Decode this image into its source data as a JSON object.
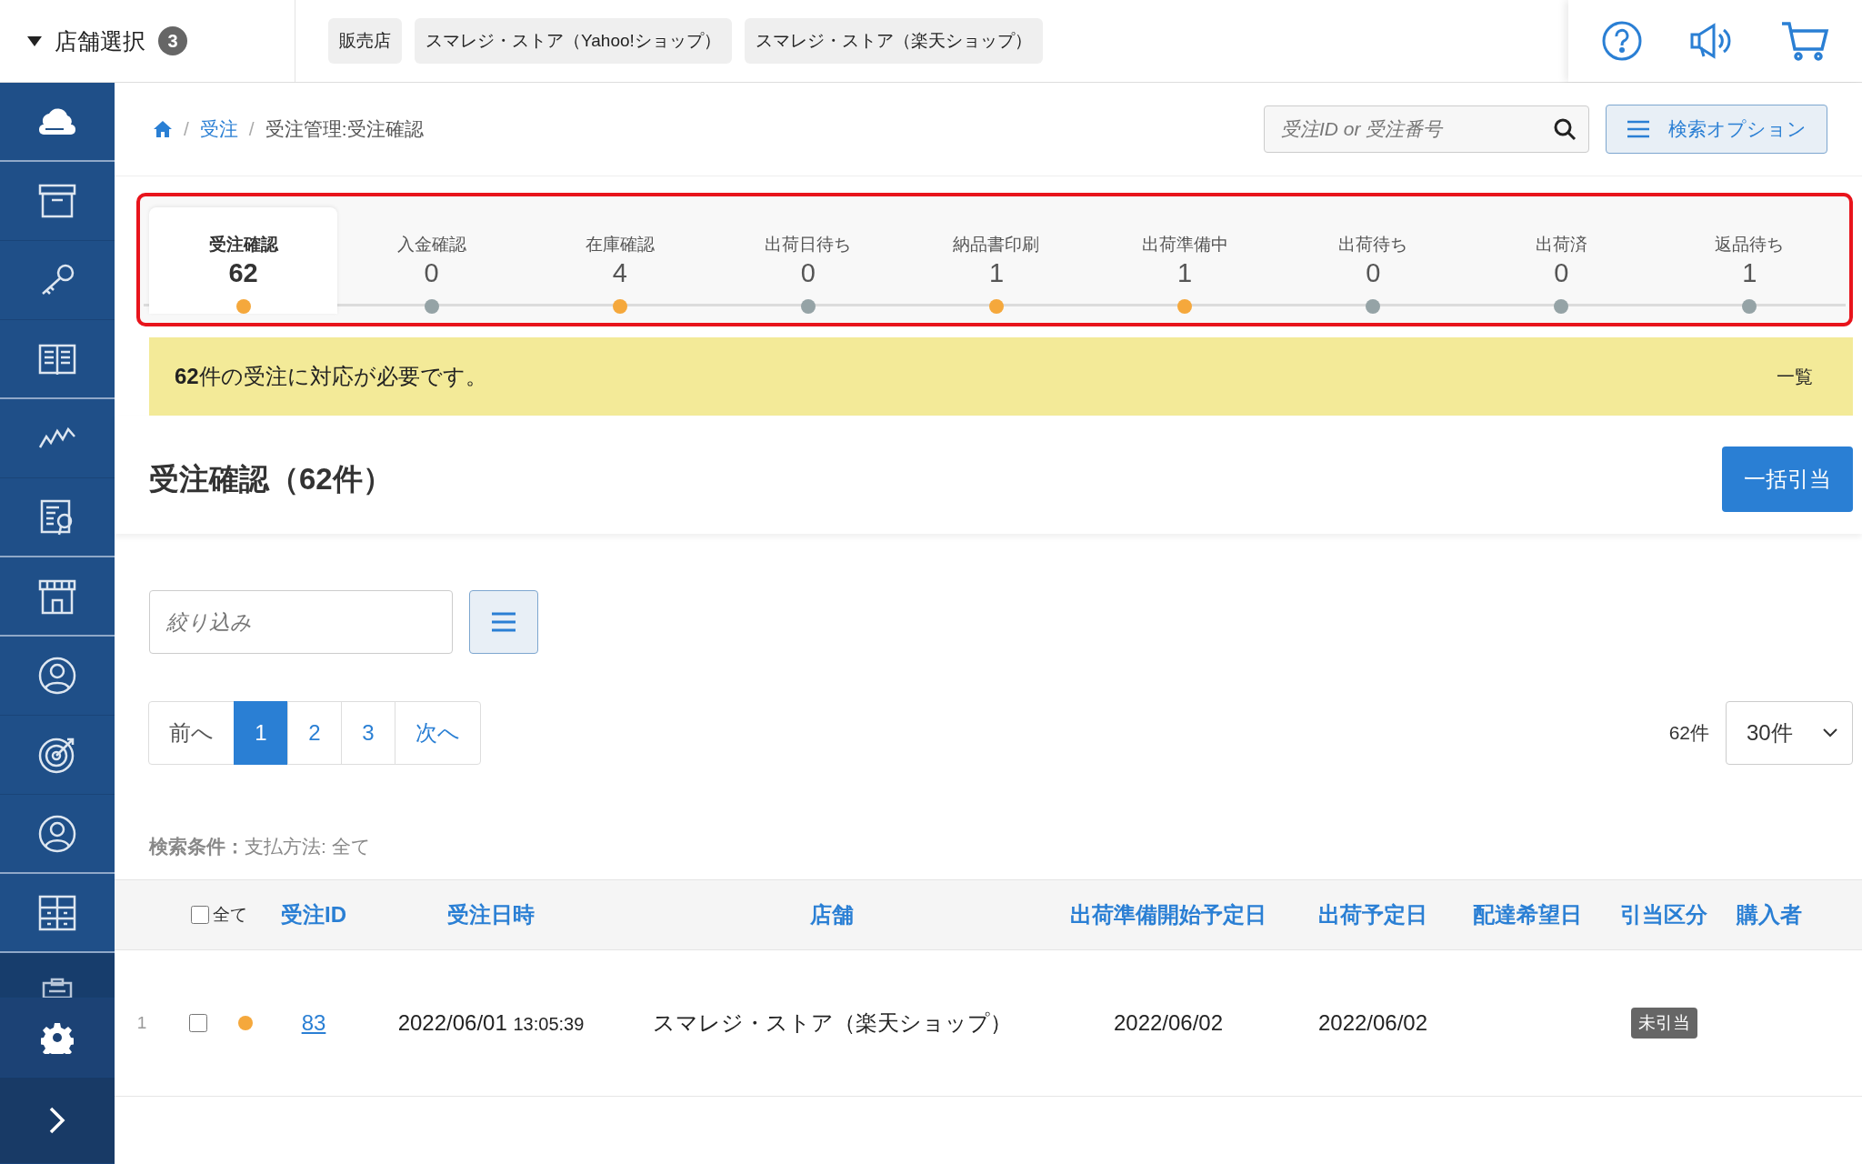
{
  "header": {
    "store_select": {
      "label": "店舗選択",
      "count": "3"
    },
    "store_chips": [
      "販売店",
      "スマレジ・ストア（Yahoo!ショップ）",
      "スマレジ・ストア（楽天ショップ）"
    ]
  },
  "breadcrumb": [
    {
      "separator": "/",
      "label": "受注",
      "link": true
    },
    {
      "separator": "/",
      "label": "受注管理:受注確認",
      "link": false
    }
  ],
  "search": {
    "placeholder": "受注ID or 受注番号"
  },
  "search_options_button": "検索オプション",
  "status_tabs": [
    {
      "label": "受注確認",
      "count": "62",
      "selected": true,
      "color": "#f5a83c"
    },
    {
      "label": "入金確認",
      "count": "0",
      "selected": false,
      "color": "#95a3a6"
    },
    {
      "label": "在庫確認",
      "count": "4",
      "selected": false,
      "color": "#f5a83c"
    },
    {
      "label": "出荷日待ち",
      "count": "0",
      "selected": false,
      "color": "#95a3a6"
    },
    {
      "label": "納品書印刷",
      "count": "1",
      "selected": false,
      "color": "#f5a83c"
    },
    {
      "label": "出荷準備中",
      "count": "1",
      "selected": false,
      "color": "#f5a83c"
    },
    {
      "label": "出荷待ち",
      "count": "0",
      "selected": false,
      "color": "#95a3a6"
    },
    {
      "label": "出荷済",
      "count": "0",
      "selected": false,
      "color": "#95a3a6"
    },
    {
      "label": "返品待ち",
      "count": "1",
      "selected": false,
      "color": "#95a3a6"
    }
  ],
  "notice": {
    "text": "**62**件の受注に対応が必要です。",
    "link": "一覧"
  },
  "section_title": "受注確認（62件）",
  "bulk_button": "一括引当",
  "filter": {
    "placeholder": "絞り込み"
  },
  "pagination": {
    "prev": "前へ",
    "pages": [
      {
        "label": "1",
        "selected": true
      },
      {
        "label": "2",
        "selected": false
      },
      {
        "label": "3",
        "selected": false
      }
    ],
    "next": "次へ"
  },
  "total": "62件",
  "per_page": "30件",
  "search_conditions": {
    "label": "検索条件：",
    "value": "支払方法: 全て"
  },
  "table": {
    "select_all": {
      "label": "全て",
      "checked": false
    },
    "columns": [
      "受注ID",
      "受注日時",
      "店舗",
      "出荷準備開始予定日",
      "出荷予定日",
      "配達希望日",
      "引当区分",
      "購入者"
    ],
    "rows": [
      {
        "index": "1",
        "checked": false,
        "color": "#f5a83c",
        "id": "83",
        "date": "2022/06/01",
        "time": "13:05:39",
        "store": "スマレジ・ストア（楽天ショップ）",
        "prep_date": "2022/06/02",
        "ship_date": "2022/06/02",
        "allocation": "未引当"
      }
    ]
  }
}
